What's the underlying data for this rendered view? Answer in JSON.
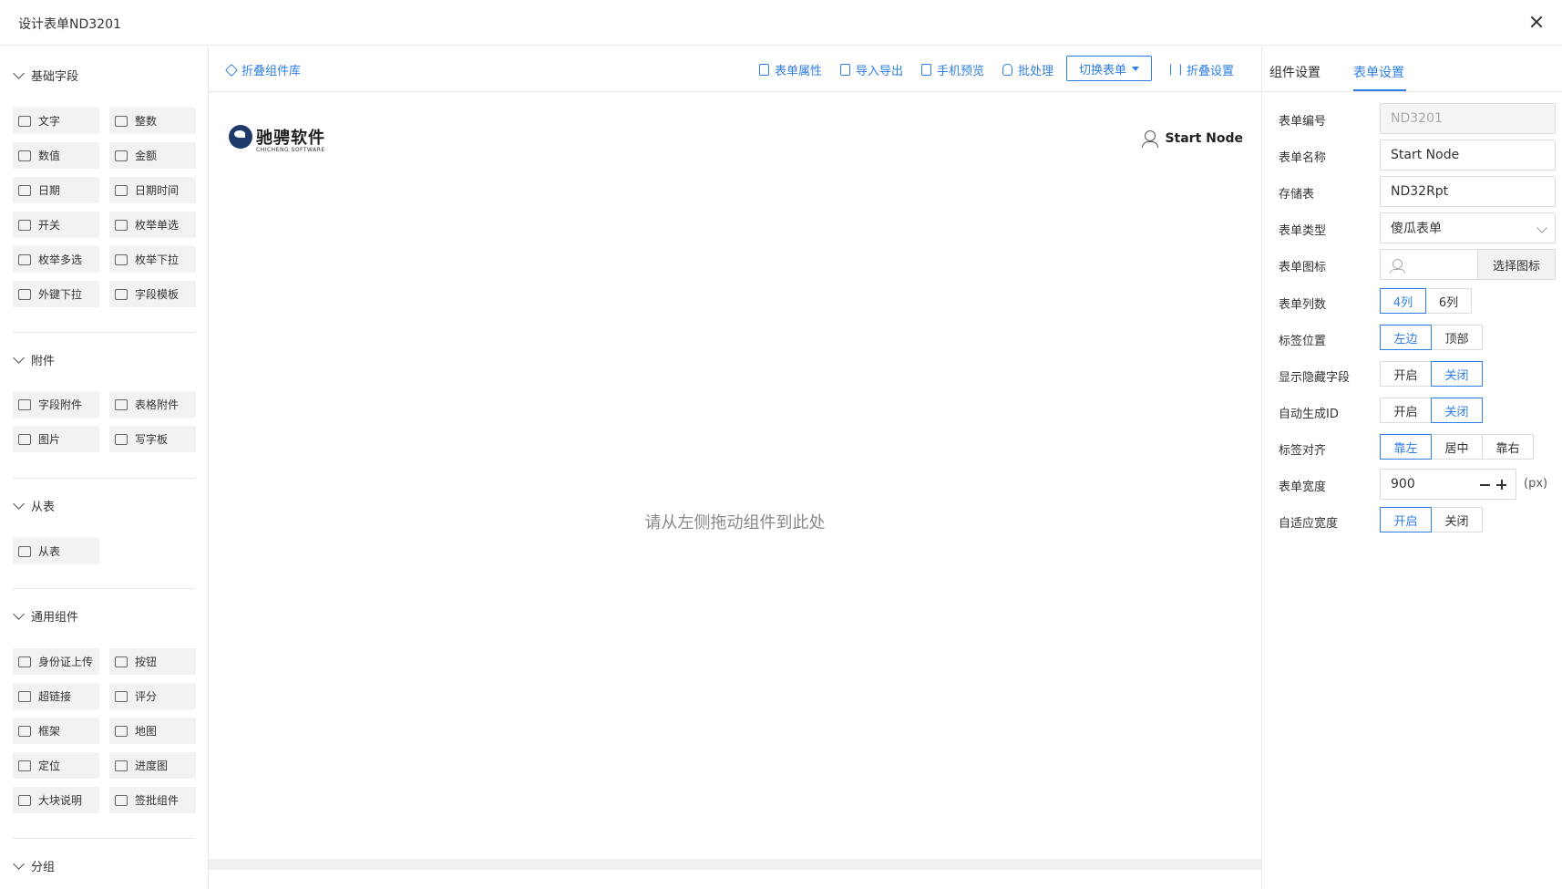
{
  "window": {
    "title": "设计表单ND3201"
  },
  "left_panel": {
    "groups": [
      {
        "title": "基础字段",
        "items": [
          {
            "label": "文字",
            "icon": "text-icon"
          },
          {
            "label": "整数",
            "icon": "integer-icon"
          },
          {
            "label": "数值",
            "icon": "number-icon"
          },
          {
            "label": "金额",
            "icon": "money-icon"
          },
          {
            "label": "日期",
            "icon": "calendar-icon"
          },
          {
            "label": "日期时间",
            "icon": "datetime-icon"
          },
          {
            "label": "开关",
            "icon": "checkbox-icon"
          },
          {
            "label": "枚举单选",
            "icon": "radio-list-icon"
          },
          {
            "label": "枚举多选",
            "icon": "multi-select-icon"
          },
          {
            "label": "枚举下拉",
            "icon": "dropdown-icon"
          },
          {
            "label": "外键下拉",
            "icon": "foreign-key-icon"
          },
          {
            "label": "字段模板",
            "icon": "template-icon"
          }
        ]
      },
      {
        "title": "附件",
        "items": [
          {
            "label": "字段附件",
            "icon": "attachment-icon"
          },
          {
            "label": "表格附件",
            "icon": "file-icon"
          },
          {
            "label": "图片",
            "icon": "image-icon"
          },
          {
            "label": "写字板",
            "icon": "pen-icon"
          }
        ]
      },
      {
        "title": "从表",
        "items": [
          {
            "label": "从表",
            "icon": "subtable-icon"
          }
        ]
      },
      {
        "title": "通用组件",
        "items": [
          {
            "label": "身份证上传",
            "icon": "id-card-icon"
          },
          {
            "label": "按钮",
            "icon": "button-icon"
          },
          {
            "label": "超链接",
            "icon": "link-icon"
          },
          {
            "label": "评分",
            "icon": "rating-icon"
          },
          {
            "label": "框架",
            "icon": "frame-icon"
          },
          {
            "label": "地图",
            "icon": "map-icon"
          },
          {
            "label": "定位",
            "icon": "location-icon"
          },
          {
            "label": "进度图",
            "icon": "progress-icon"
          },
          {
            "label": "大块说明",
            "icon": "code-icon"
          },
          {
            "label": "签批组件",
            "icon": "sign-icon"
          }
        ]
      },
      {
        "title": "分组",
        "items": []
      }
    ]
  },
  "toolbar": {
    "collapse_library": "折叠组件库",
    "form_properties": "表单属性",
    "import_export": "导入导出",
    "mobile_preview": "手机预览",
    "batch": "批处理",
    "switch_form": "切换表单",
    "collapse_settings": "折叠设置"
  },
  "canvas": {
    "logo_cn": "驰骋软件",
    "logo_en": "CHICHENG SOFTWARE",
    "node_name": "Start Node",
    "placeholder": "请从左侧拖动组件到此处"
  },
  "right_panel": {
    "tabs": [
      "组件设置",
      "表单设置"
    ],
    "active_tab": "表单设置",
    "fields": {
      "form_no": {
        "label": "表单编号",
        "value": "ND3201"
      },
      "form_name": {
        "label": "表单名称",
        "value": "Start Node"
      },
      "storage": {
        "label": "存储表",
        "value": "ND32Rpt"
      },
      "form_type": {
        "label": "表单类型",
        "value": "傻瓜表单"
      },
      "form_icon": {
        "label": "表单图标",
        "button": "选择图标"
      },
      "columns": {
        "label": "表单列数",
        "options": [
          "4列",
          "6列"
        ],
        "selected": "4列"
      },
      "label_pos": {
        "label": "标签位置",
        "options": [
          "左边",
          "顶部"
        ],
        "selected": "左边"
      },
      "show_hidden": {
        "label": "显示隐藏字段",
        "options": [
          "开启",
          "关闭"
        ],
        "selected": "关闭"
      },
      "auto_id": {
        "label": "自动生成ID",
        "options": [
          "开启",
          "关闭"
        ],
        "selected": "关闭"
      },
      "label_align": {
        "label": "标签对齐",
        "options": [
          "靠左",
          "居中",
          "靠右"
        ],
        "selected": "靠左"
      },
      "form_width": {
        "label": "表单宽度",
        "value": "900",
        "unit": "(px)"
      },
      "adaptive_width": {
        "label": "自适应宽度",
        "options": [
          "开启",
          "关闭"
        ],
        "selected": "开启"
      }
    }
  },
  "colors": {
    "accent": "#2f7ee6",
    "component_bg": "#f2f2f2",
    "border": "#e8e8e8"
  }
}
